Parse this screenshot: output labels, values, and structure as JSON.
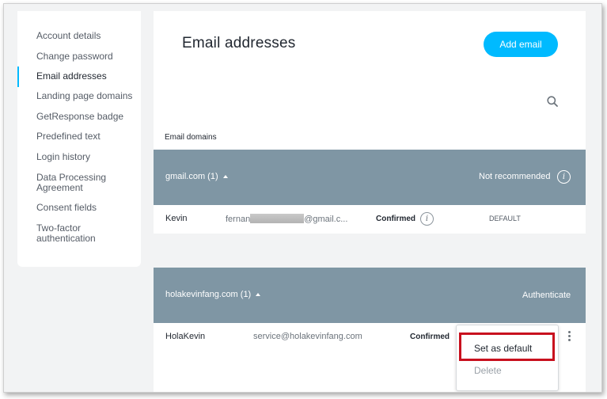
{
  "sidebar": {
    "items": [
      {
        "label": "Account details",
        "active": false
      },
      {
        "label": "Change password",
        "active": false
      },
      {
        "label": "Email addresses",
        "active": true
      },
      {
        "label": "Landing page domains",
        "active": false
      },
      {
        "label": "GetResponse badge",
        "active": false
      },
      {
        "label": "Predefined text",
        "active": false
      },
      {
        "label": "Login history",
        "active": false
      },
      {
        "label": "Data Processing Agreement",
        "active": false
      },
      {
        "label": "Consent fields",
        "active": false
      },
      {
        "label": "Two-factor authentication",
        "active": false
      }
    ]
  },
  "header": {
    "title": "Email addresses",
    "add_label": "Add email"
  },
  "list": {
    "section_label": "Email domains",
    "domains": [
      {
        "name": "gmail.com (1)",
        "status": "Not recommended",
        "rows": [
          {
            "name": "Kevin",
            "email_prefix": "fernan",
            "email_suffix": "@gmail.c...",
            "state": "Confirmed",
            "default_label": "DEFAULT"
          }
        ]
      },
      {
        "name": "holakevinfang.com (1)",
        "status": "Authenticate",
        "rows": [
          {
            "name": "HolaKevin",
            "email": "service@holakevinfang.com",
            "state": "Confirmed"
          }
        ]
      }
    ]
  },
  "context_menu": {
    "items": [
      {
        "label": "Set as default",
        "disabled": false
      },
      {
        "label": "Delete",
        "disabled": true
      }
    ]
  },
  "colors": {
    "accent": "#00baff",
    "domain_bar": "#7f96a4",
    "highlight": "#c8101e"
  },
  "icons": [
    "search-icon",
    "info-icon",
    "caret-up-icon",
    "kebab-menu-icon"
  ]
}
